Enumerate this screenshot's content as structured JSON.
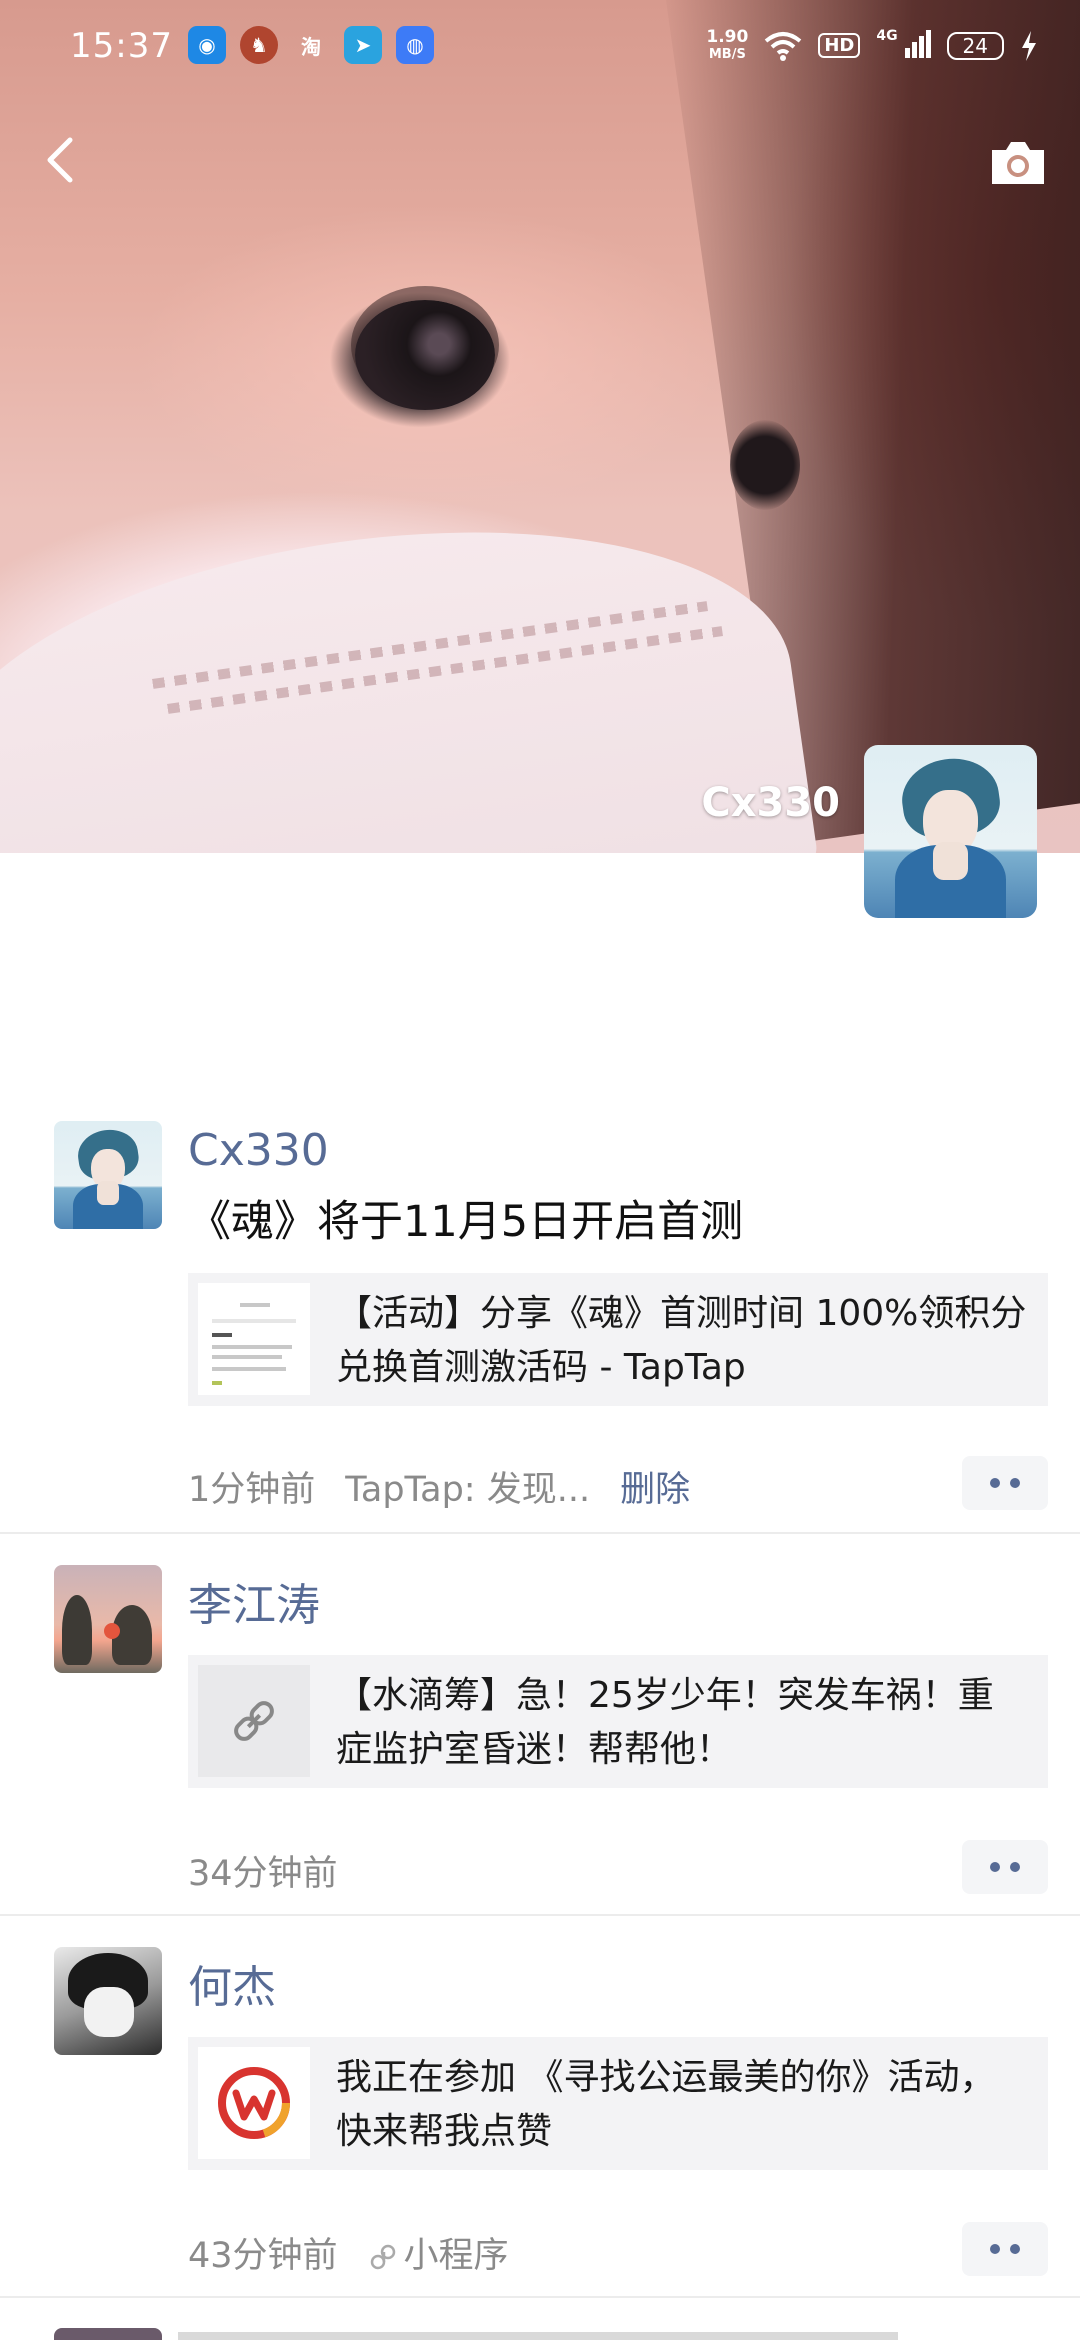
{
  "status_bar": {
    "time": "15:37",
    "apps": [
      "qq-browser",
      "game",
      "淘",
      "telegram",
      "messages"
    ],
    "net_speed_value": "1.90",
    "net_speed_unit": "MB/S",
    "hd": "HD",
    "network": "4G",
    "battery": "24"
  },
  "cover": {
    "owner_name": "Cx330"
  },
  "posts": [
    {
      "author": "Cx330",
      "text": "《魂》将于11月5日开启首测",
      "card_text": "【活动】分享《魂》首测时间 100%领积分兑换首测激活码 - TapTap",
      "time": "1分钟前",
      "source": "TapTap: 发现...",
      "delete": "删除"
    },
    {
      "author": "李江涛",
      "card_text": "【水滴筹】急！25岁少年！突发车祸！重症监护室昏迷！帮帮他！",
      "time": "34分钟前"
    },
    {
      "author": "何杰",
      "card_text": "我正在参加 《寻找公运最美的你》活动，快来帮我点赞",
      "time": "43分钟前",
      "source": "小程序"
    }
  ],
  "colors": {
    "link_blue": "#576b95",
    "meta_gray": "#8a8a8a",
    "card_bg": "#f3f3f5"
  }
}
